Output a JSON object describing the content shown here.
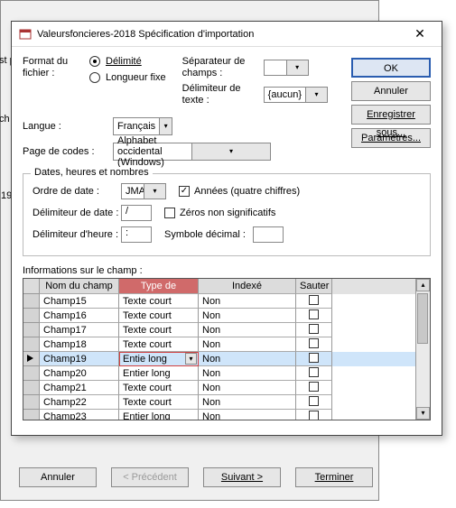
{
  "backtext": {
    "frag1": "st p",
    "frag2": "ch",
    "frag3": "19"
  },
  "title": "Valeursfoncieres-2018 Spécification d'importation",
  "format": {
    "label": "Format du fichier :",
    "delimited": "Délimité",
    "fixed": "Longueur fixe"
  },
  "separator": {
    "label": "Séparateur de champs :",
    "value": ""
  },
  "text_delim": {
    "label": "Délimiteur de texte :",
    "value": "{aucun}"
  },
  "buttons": {
    "ok": "OK",
    "cancel": "Annuler",
    "saveas": "Enregistrer sous...",
    "params": "Paramètres..."
  },
  "langue": {
    "label": "Langue :",
    "value": "Français"
  },
  "codepage": {
    "label": "Page de codes :",
    "value": "Alphabet occidental (Windows)"
  },
  "group": {
    "legend": "Dates, heures et nombres",
    "dateorder_label": "Ordre de date :",
    "dateorder_value": "JMA",
    "datedelim_label": "Délimiteur de date :",
    "datedelim_value": "/",
    "timedelim_label": "Délimiteur d'heure :",
    "timedelim_value": ":",
    "years4": "Années (quatre chiffres)",
    "nonzeros": "Zéros non significatifs",
    "decsym_label": "Symbole décimal :",
    "decsym_value": ""
  },
  "fieldinfo": "Informations sur le champ :",
  "table": {
    "headers": {
      "name": "Nom du champ",
      "type": "Type de données",
      "indexed": "Indexé",
      "skip": "Sauter"
    },
    "rows": [
      {
        "name": "Champ15",
        "type": "Texte court",
        "indexed": "Non"
      },
      {
        "name": "Champ16",
        "type": "Texte court",
        "indexed": "Non"
      },
      {
        "name": "Champ17",
        "type": "Texte court",
        "indexed": "Non"
      },
      {
        "name": "Champ18",
        "type": "Texte court",
        "indexed": "Non"
      },
      {
        "name": "Champ19",
        "type": "Entie long",
        "indexed": "Non",
        "selected": true
      },
      {
        "name": "Champ20",
        "type": "Entier long",
        "indexed": "Non"
      },
      {
        "name": "Champ21",
        "type": "Texte court",
        "indexed": "Non"
      },
      {
        "name": "Champ22",
        "type": "Texte court",
        "indexed": "Non"
      },
      {
        "name": "Champ23",
        "type": "Entier long",
        "indexed": "Non"
      }
    ]
  },
  "wizard": {
    "cancel": "Annuler",
    "prev": "< Précédent",
    "next": "Suivant >",
    "finish": "Terminer"
  }
}
